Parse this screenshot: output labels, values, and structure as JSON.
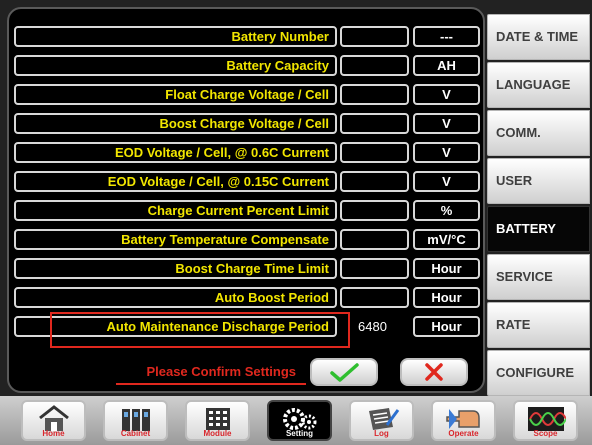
{
  "rows": [
    {
      "label": "Battery Number",
      "value": "",
      "unit": "---"
    },
    {
      "label": "Battery Capacity",
      "value": "",
      "unit": "AH"
    },
    {
      "label": "Float Charge Voltage / Cell",
      "value": "",
      "unit": "V"
    },
    {
      "label": "Boost Charge Voltage / Cell",
      "value": "",
      "unit": "V"
    },
    {
      "label": "EOD Voltage / Cell, @ 0.6C Current",
      "value": "",
      "unit": "V"
    },
    {
      "label": "EOD Voltage / Cell, @ 0.15C Current",
      "value": "",
      "unit": "V"
    },
    {
      "label": "Charge Current Percent Limit",
      "value": "",
      "unit": "%"
    },
    {
      "label": "Battery Temperature Compensate",
      "value": "",
      "unit": "mV/°C"
    },
    {
      "label": "Boost Charge Time Limit",
      "value": "",
      "unit": "Hour"
    },
    {
      "label": "Auto Boost Period",
      "value": "",
      "unit": "Hour"
    },
    {
      "label": "Auto Maintenance Discharge Period",
      "value": "6480",
      "unit": "Hour"
    }
  ],
  "confirm": {
    "text": "Please Confirm Settings"
  },
  "tabs": [
    {
      "label": "DATE & TIME",
      "active": false
    },
    {
      "label": "LANGUAGE",
      "active": false
    },
    {
      "label": "COMM.",
      "active": false
    },
    {
      "label": "USER",
      "active": false
    },
    {
      "label": "BATTERY",
      "active": true
    },
    {
      "label": "SERVICE",
      "active": false
    },
    {
      "label": "RATE",
      "active": false
    },
    {
      "label": "CONFIGURE",
      "active": false
    }
  ],
  "nav": [
    {
      "label": "Home",
      "icon": "home-icon",
      "active": false
    },
    {
      "label": "Cabinet",
      "icon": "cabinet-icon",
      "active": false
    },
    {
      "label": "Module",
      "icon": "module-icon",
      "active": false
    },
    {
      "label": "Setting",
      "icon": "gear-icon",
      "active": true
    },
    {
      "label": "Log",
      "icon": "log-icon",
      "active": false
    },
    {
      "label": "Operate",
      "icon": "operate-icon",
      "active": false
    },
    {
      "label": "Scope",
      "icon": "scope-icon",
      "active": false
    }
  ],
  "colors": {
    "label_text": "#f2e600",
    "warning": "#e0281e",
    "confirm_check": "#2fbf2f",
    "cancel_x": "#e0281e"
  }
}
